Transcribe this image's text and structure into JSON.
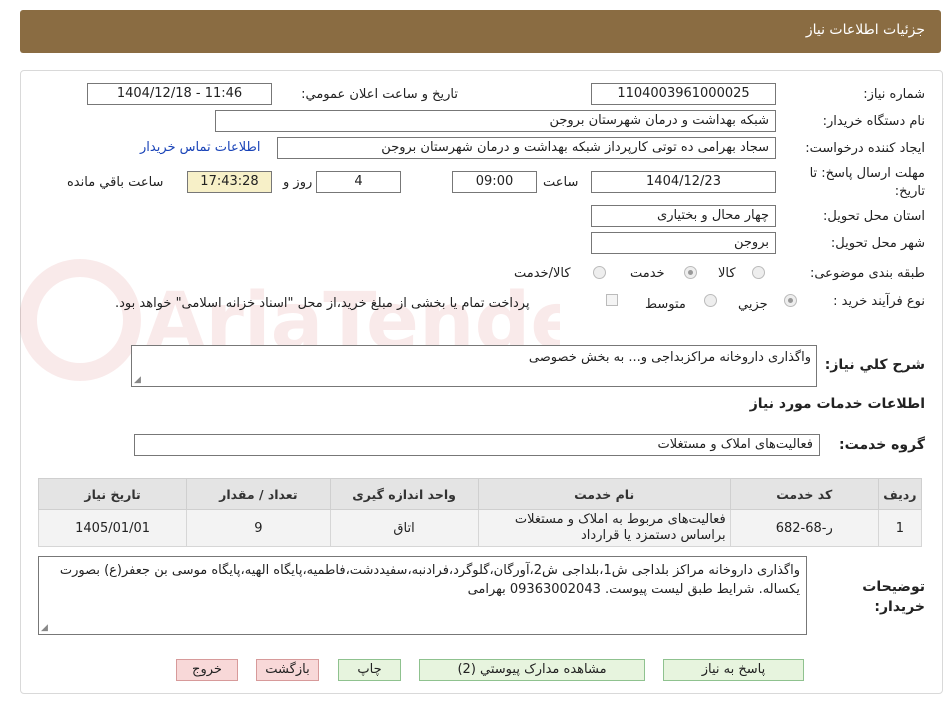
{
  "header": {
    "title": "جزئیات اطلاعات نیاز"
  },
  "form": {
    "need_number_label": "شماره نیاز:",
    "need_number": "1104003961000025",
    "announce_label": "تاریخ و ساعت اعلان عمومي:",
    "announce_value": "1404/12/18 - 11:46",
    "buyer_org_label": "نام دستگاه خریدار:",
    "buyer_org": "شبکه بهداشت و درمان شهرستان بروجن",
    "requester_label": "ایجاد کننده درخواست:",
    "requester": "سجاد بهرامی ده توتی کارپرداز شبکه بهداشت و درمان شهرستان بروجن",
    "contact_link": "اطلاعات تماس خریدار",
    "deadline_label": "مهلت ارسال پاسخ: تا تاریخ:",
    "deadline_date": "1404/12/23",
    "time_label": "ساعت",
    "deadline_time": "09:00",
    "days_value": "4",
    "days_label": "روز و",
    "remaining_time": "17:43:28",
    "remaining_label": "ساعت باقي مانده",
    "province_label": "استان محل تحویل:",
    "province": "چهار محال و بختیاری",
    "city_label": "شهر محل تحویل:",
    "city": "بروجن",
    "category_label": "طبقه بندی موضوعی:",
    "category_options": [
      "کالا",
      "خدمت",
      "کالا/خدمت"
    ],
    "category_selected": "خدمت",
    "process_label": "نوع فرآیند خرید :",
    "process_options": [
      "جزیي",
      "متوسط"
    ],
    "process_selected": "جزیي",
    "payment_note": "پرداخت تمام یا بخشی از مبلغ خرید،از محل \"اسناد خزانه اسلامی\" خواهد بود."
  },
  "summary": {
    "label": "شرح کلي نیاز:",
    "value": "واگذاری داروخانه مراکزبداجی و... به بخش خصوصی"
  },
  "services": {
    "section_title": "اطلاعات خدمات مورد نیاز",
    "group_label": "گروه خدمت:",
    "group_value": "فعالیت‌های  املاک و مستغلات",
    "columns": [
      "ردیف",
      "کد خدمت",
      "نام خدمت",
      "واحد اندازه گیری",
      "تعداد / مقدار",
      "تاریخ نیاز"
    ],
    "rows": [
      {
        "row": "1",
        "code": "ر-68-682",
        "name": "فعالیت‌های مربوط به املاک و مستغلات براساس دستمزد یا قرارداد",
        "unit": "اتاق",
        "qty": "9",
        "date": "1405/01/01"
      }
    ]
  },
  "notes": {
    "label": "توضیحات خریدار:",
    "value": "واگذاری داروخانه مراکز بلداجی ش1،بلداجی ش2،آورگان،گلوگرد،فرادنبه،سفیددشت،فاطمیه،پایگاه الهیه،پایگاه موسی بن جعفر(ع) بصورت یکساله.  شرایط طبق لیست پیوست. 09363002043 بهرامی"
  },
  "buttons": {
    "reply": "پاسخ به نیاز",
    "attachments": "مشاهده مدارک پیوستي (2)",
    "print": "چاپ",
    "back": "بازگشت",
    "exit": "خروج"
  },
  "watermark": {
    "text": "AriaTender.neT"
  },
  "colors": {
    "header_bg": "#8a6c42",
    "link": "#1a44b8",
    "green_btn": "#e7f4de",
    "red_btn": "#f8d8d8"
  }
}
